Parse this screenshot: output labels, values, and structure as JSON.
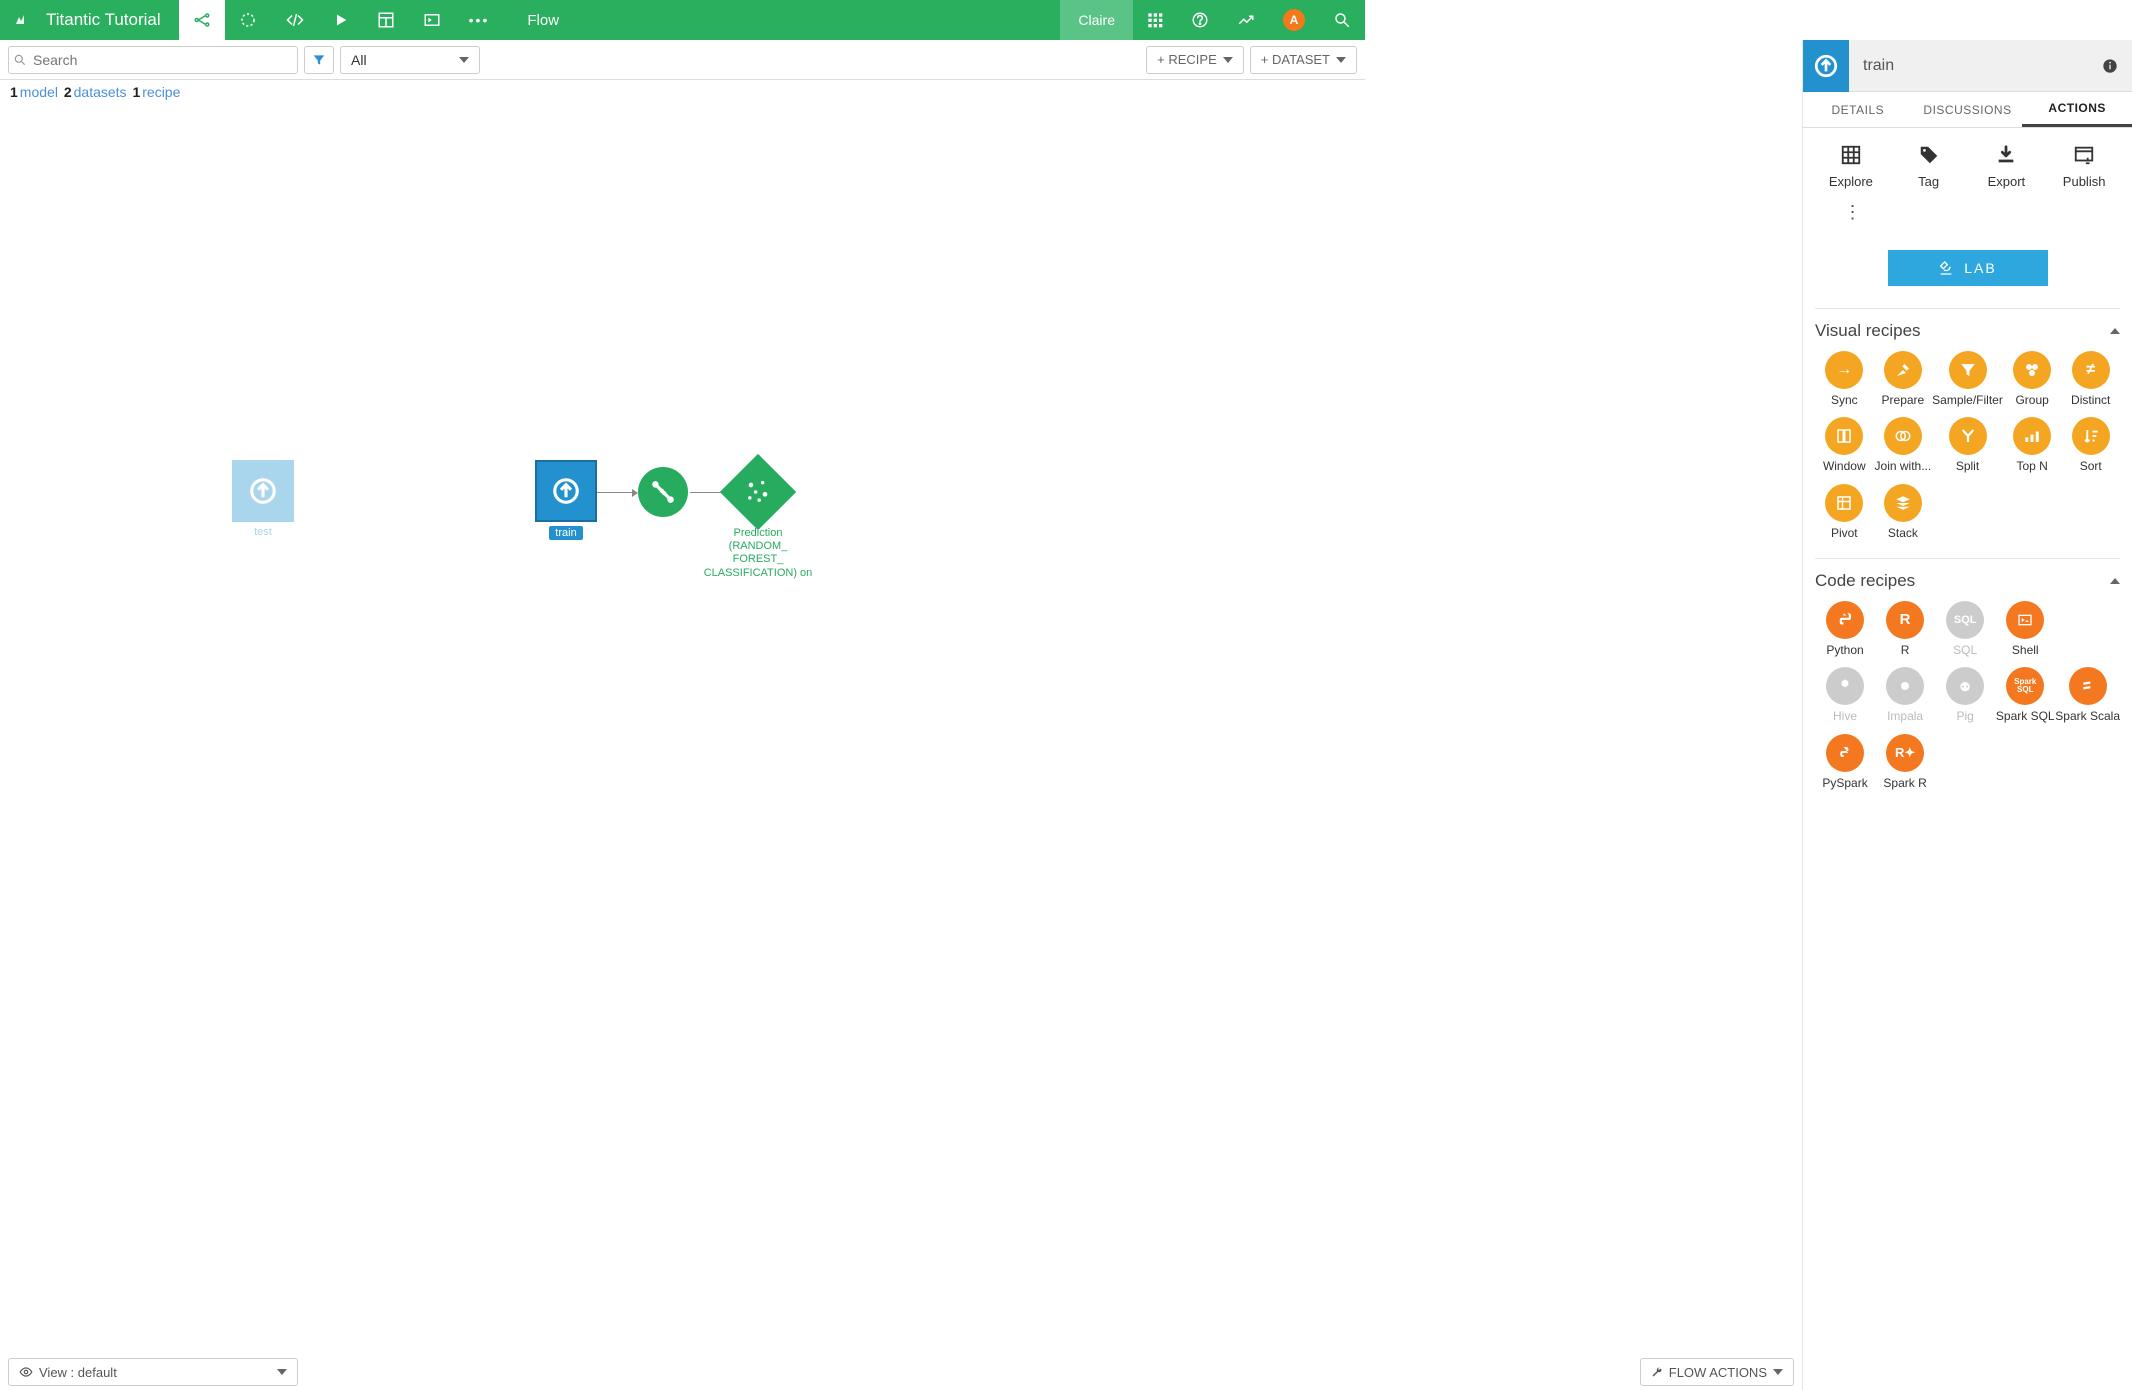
{
  "header": {
    "project": "Titantic Tutorial",
    "breadcrumb": "Flow",
    "user": "Claire",
    "avatar_initial": "A"
  },
  "toolbar": {
    "search_placeholder": "Search",
    "filter_dropdown": "All",
    "add_recipe": "+ RECIPE",
    "add_dataset": "+ DATASET"
  },
  "counts": {
    "model_n": "1",
    "model_lbl": "model",
    "datasets_n": "2",
    "datasets_lbl": "datasets",
    "recipe_n": "1",
    "recipe_lbl": "recipe"
  },
  "flow": {
    "node_test": "test",
    "node_train": "train",
    "node_pred": "Prediction (RANDOM_\nFOREST_\nCLASSIFICATION) on"
  },
  "bottom": {
    "view_label": "View : default",
    "flow_actions": "FLOW ACTIONS"
  },
  "panel": {
    "title": "train",
    "tabs": {
      "details": "DETAILS",
      "discussions": "DISCUSSIONS",
      "actions": "ACTIONS"
    },
    "actions": {
      "explore": "Explore",
      "tag": "Tag",
      "export": "Export",
      "publish": "Publish"
    },
    "lab": "LAB",
    "visual_header": "Visual recipes",
    "visual": {
      "sync": "Sync",
      "prepare": "Prepare",
      "sample": "Sample/Filter",
      "group": "Group",
      "distinct": "Distinct",
      "window": "Window",
      "join": "Join with...",
      "split": "Split",
      "topn": "Top N",
      "sort": "Sort",
      "pivot": "Pivot",
      "stack": "Stack"
    },
    "code_header": "Code recipes",
    "code": {
      "python": "Python",
      "r": "R",
      "sql": "SQL",
      "shell": "Shell",
      "hive": "Hive",
      "impala": "Impala",
      "pig": "Pig",
      "sparksql": "Spark SQL",
      "sparkscala": "Spark Scala",
      "pyspark": "PySpark",
      "sparkr": "Spark R"
    }
  }
}
